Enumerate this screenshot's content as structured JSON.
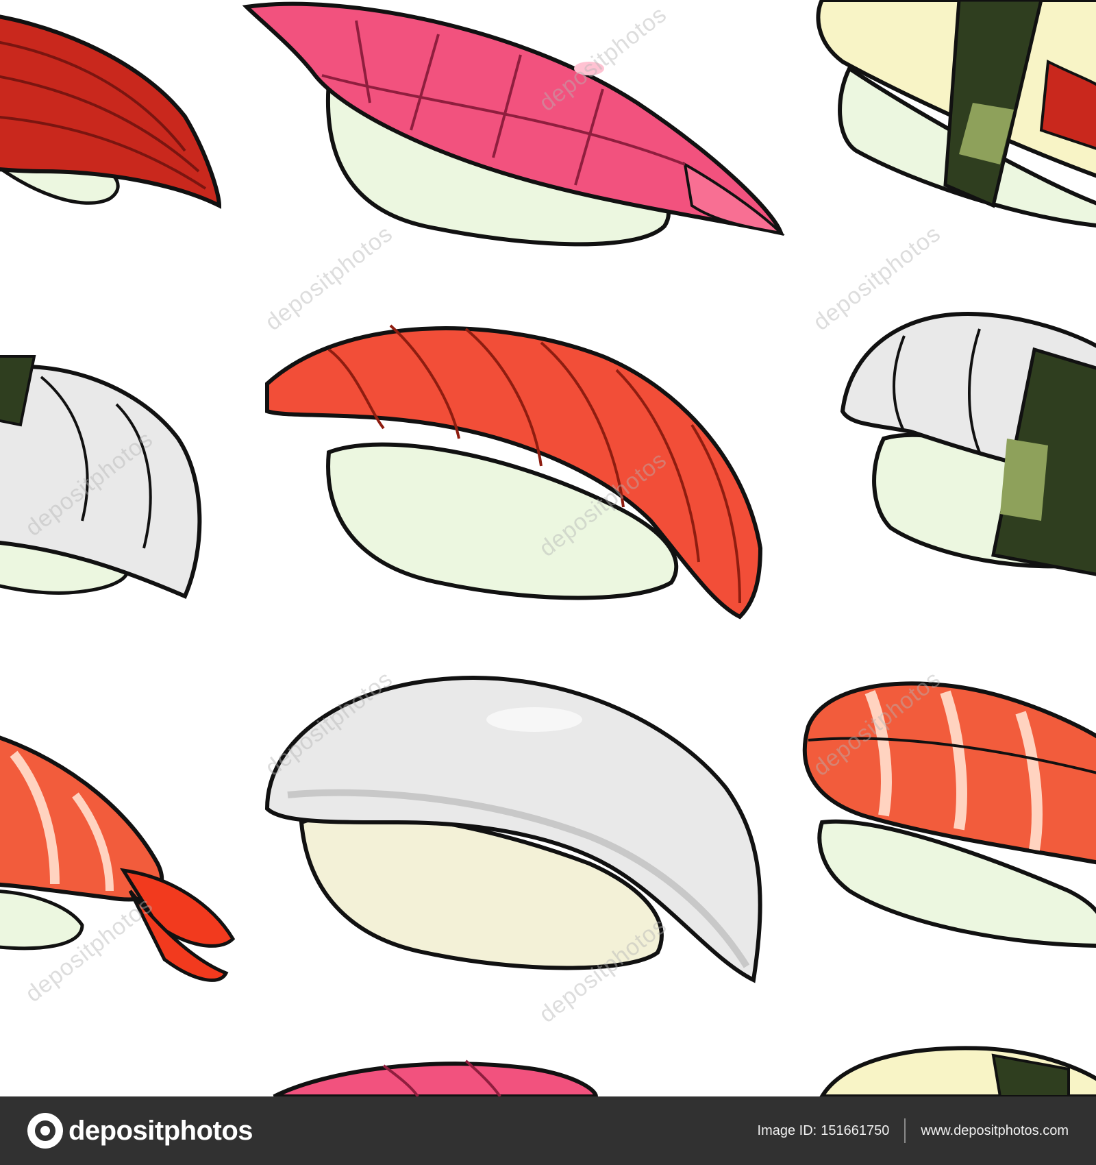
{
  "watermark_text": "depositphotos",
  "footer": {
    "logo_text": "depositphotos",
    "image_id_label": "Image ID:",
    "image_id": "151661750",
    "site_url": "www.depositphotos.com"
  },
  "colors": {
    "background": "#ffffff",
    "footer_bar": "#313131",
    "outline": "#111111",
    "rice": "#ecf7e0",
    "rice_shadow": "#c9e3b5",
    "tuna_pink": "#f2527e",
    "salmon": "#f24e38",
    "squid_white": "#e9e9e9",
    "shrimp_orange": "#f25c3c",
    "nori": "#2f3e1f",
    "tamago": "#f8f4c6",
    "red_tuna": "#c9281d"
  },
  "icons": {
    "logo_mark": "depositphotos-logo-icon"
  }
}
